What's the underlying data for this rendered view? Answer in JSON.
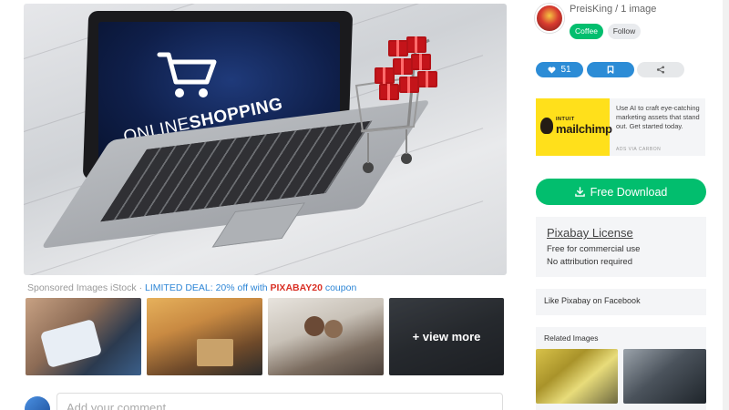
{
  "main_image": {
    "screen_text_light": "ONLINE",
    "screen_text_bold": "SHOPPING"
  },
  "sponsored": {
    "prefix": "Sponsored Images iStock · ",
    "deal": "LIMITED DEAL: 20% off with ",
    "code": "PIXABAY20",
    "suffix": " coupon"
  },
  "thumbnails": {
    "view_more": "+ view more"
  },
  "comment": {
    "placeholder": "Add your comment"
  },
  "author": {
    "name": "PreisKing / 1 image",
    "coffee_label": "Coffee",
    "follow_label": "Follow"
  },
  "actions": {
    "like_count": "51"
  },
  "ad": {
    "brand_top": "INTUIT",
    "brand": "mailchimp",
    "text": "Use AI to craft eye-catching marketing assets that stand out. Get started today.",
    "via": "ADS VIA CARBON"
  },
  "download": {
    "label": "Free Download"
  },
  "license": {
    "title": "Pixabay License",
    "line1": "Free for commercial use",
    "line2": "No attribution required"
  },
  "facebook": {
    "label": "Like Pixabay on Facebook"
  },
  "related": {
    "title": "Related Images"
  },
  "colors": {
    "accent_green": "#02be6e",
    "accent_blue": "#2c8cd6",
    "deal_blue": "#2e86d6",
    "code_red": "#d93025",
    "panel_gray": "#f4f5f7"
  }
}
